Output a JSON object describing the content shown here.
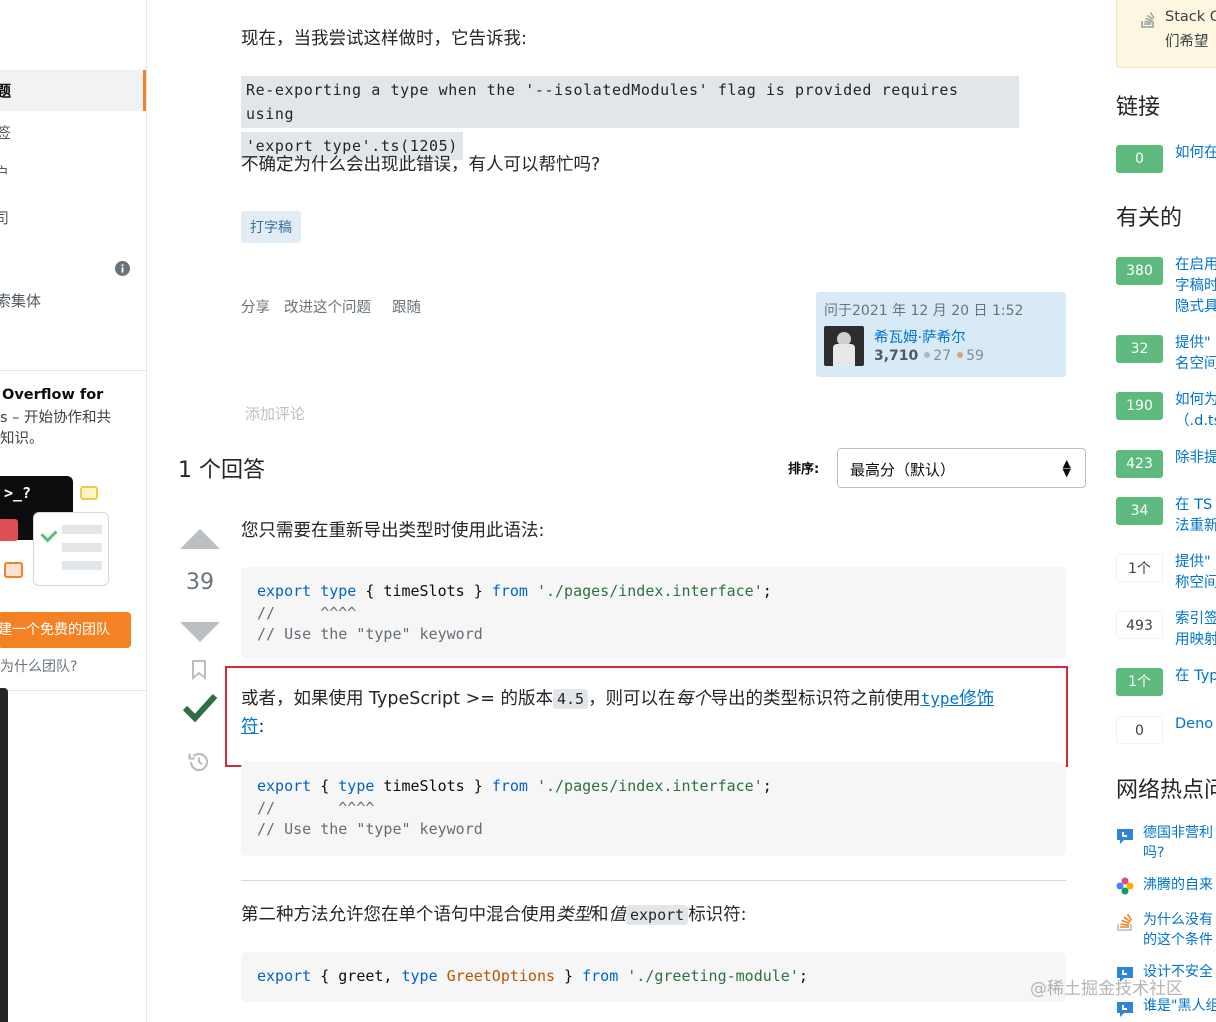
{
  "left_nav": {
    "active_item": "题",
    "items": [
      "签",
      "户",
      "司"
    ],
    "collectives_label": "索集体",
    "teams_title": "Overflow for",
    "teams_desc_line1": "s – 开始协作和共",
    "teams_desc_line2": "知识。",
    "terminal_text": ">_?",
    "free_team_button": "建一个免费的团队",
    "why_teams": "为什么团队?"
  },
  "question": {
    "intro": "现在，当我尝试这样做时，它告诉我:",
    "error_line1": "Re-exporting a type when the '--isolatedModules' flag is provided requires using",
    "error_line2": "'export type'.ts(1205)",
    "ask": "不确定为什么会出现此错误，有人可以帮忙吗?",
    "tag": "打字稿",
    "menu": [
      "分享",
      "改进这个问题",
      "跟随"
    ],
    "owner": {
      "asked": "问于2021 年 12 月 20 日 1:52",
      "name": "希瓦姆·萨希尔",
      "rep": "3,710",
      "silver": "27",
      "bronze": "59"
    },
    "add_comment": "添加评论"
  },
  "answers": {
    "count_label": "1 个回答",
    "sort_label": "排序:",
    "sort_value": "最高分（默认）"
  },
  "answer": {
    "votes": "39",
    "p1": "您只需要在重新导出类型时使用此语法:",
    "code1": {
      "l1_export": "export",
      "l1_type": "type",
      "l1_mid": " { timeSlots } ",
      "l1_from": "from",
      "l1_str": "'./pages/index.interface'",
      "l1_end": ";",
      "l2": "//     ^^^^",
      "l3": "// Use the \"type\" keyword"
    },
    "p2_a": "或者，如果使用 TypeScript >= 的版本",
    "p2_code": "4.5",
    "p2_b": "，则可以在",
    "p2_em": "每个",
    "p2_c": "导出的类型标识符之前使用",
    "p2_link_code": "type",
    "p2_link_text": "修饰",
    "p2_d": "符",
    "p2_e": ":",
    "code2": {
      "l1_export": "export",
      "l1_a": " { ",
      "l1_type": "type",
      "l1_b": " timeSlots } ",
      "l1_from": "from",
      "l1_str": "'./pages/index.interface'",
      "l1_end": ";",
      "l2": "//       ^^^^",
      "l3": "// Use the \"type\" keyword"
    },
    "p3_a": "第二种方法允许您在单个语句中混合使用",
    "p3_em1": "类型",
    "p3_b": "和",
    "p3_em2": "值",
    "p3_code": "export",
    "p3_c": "标识符:",
    "code3": {
      "export": "export",
      "a": " { greet, ",
      "type": "type",
      "b": " ",
      "ty": "GreetOptions",
      "c": " } ",
      "from": "from",
      "str": "'./greeting-module'",
      "end": ";"
    }
  },
  "right_sidebar": {
    "blog_line1": "Stack O",
    "blog_line2": "们希望",
    "links_heading": "链接",
    "links": [
      {
        "score": "0",
        "lines": [
          "如何在"
        ]
      }
    ],
    "related_heading": "有关的",
    "related": [
      {
        "score": "380",
        "lines": [
          "在启用",
          "字稿时",
          "隐式具"
        ]
      },
      {
        "score": "32",
        "lines": [
          "提供\"",
          "名空间"
        ]
      },
      {
        "score": "190",
        "lines": [
          "如何为",
          "（.d.ts"
        ]
      },
      {
        "score": "423",
        "lines": [
          "除非提"
        ]
      },
      {
        "score": "34",
        "lines": [
          "在 TS",
          "法重新"
        ]
      },
      {
        "score": "1个",
        "lines": [
          "提供\"",
          "称空间"
        ]
      },
      {
        "score": "493",
        "lines": [
          "索引签",
          "用映射"
        ]
      },
      {
        "score": "1个",
        "lines": [
          "在 Typ"
        ]
      },
      {
        "score": "0",
        "lines": [
          "Deno"
        ]
      }
    ],
    "hot_heading": "网络热点问",
    "hot": [
      {
        "icon": "chat-bubble-icon",
        "lines": [
          "德国非营利",
          "吗?"
        ]
      },
      {
        "icon": "colorful-flower-icon",
        "lines": [
          "沸腾的自来"
        ]
      },
      {
        "icon": "stack-icon",
        "lines": [
          "为什么没有",
          "的这个条件"
        ]
      },
      {
        "icon": "chat-bubble-icon",
        "lines": [
          "设计不安全"
        ]
      },
      {
        "icon": "chat-bubble-icon",
        "lines": [
          "谁是\"黑人组"
        ]
      }
    ]
  },
  "watermark": "@稀土掘金技术社区",
  "colors": {
    "accent_orange": "#f48225",
    "link_blue": "#0074cc",
    "accepted_green": "#2f6f44",
    "highlight_red": "#d12a30",
    "score_green": "#5eba7d"
  }
}
